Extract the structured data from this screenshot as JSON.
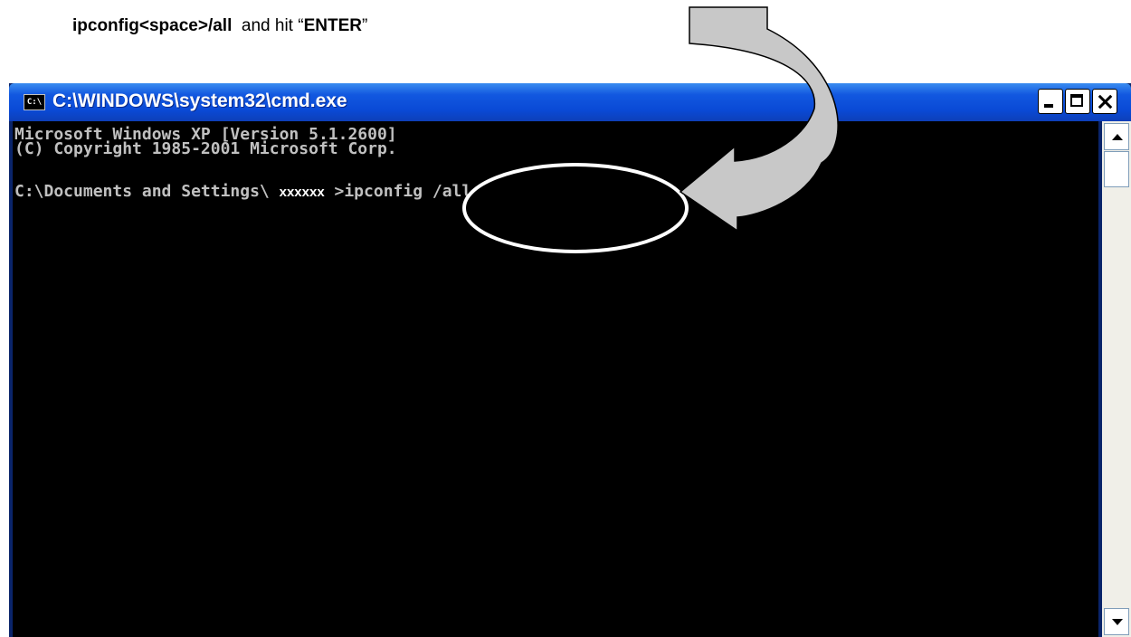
{
  "instruction": {
    "command": "ipconfig<space>/all",
    "text_middle": "  and hit “",
    "key": "ENTER",
    "text_end": "”"
  },
  "window": {
    "title": "C:\\WINDOWS\\system32\\cmd.exe",
    "icon_label": "C:\\",
    "icon": "console-app-icon",
    "buttons": [
      "minimize-icon",
      "maximize-icon",
      "close-icon"
    ]
  },
  "console": {
    "line1": "Microsoft Windows XP [Version 5.1.2600]",
    "line2": "(C) Copyright 1985-2001 Microsoft Corp.",
    "prompt_prefix": "C:\\Documents and Settings\\ ",
    "username_masked": "xxxxxx",
    "prompt_suffix": " >ipconfig /all"
  },
  "colors": {
    "titlebar": "#0a4ad6",
    "console_bg": "#000000",
    "console_text": "#c0c0c0",
    "arrow_fill": "#c8c8c8",
    "highlight_ellipse": "#ffffff"
  }
}
